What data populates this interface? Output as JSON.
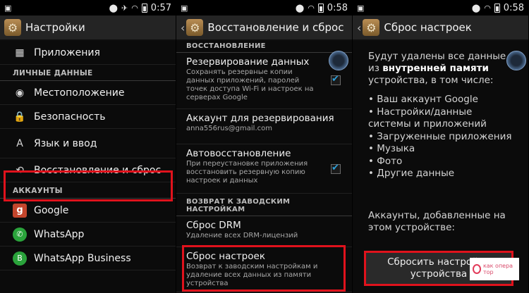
{
  "screen1": {
    "status": {
      "time": "0:57"
    },
    "title": "Настройки",
    "items": [
      {
        "kind": "row",
        "name": "menu-apps",
        "icon": "apps-icon",
        "label": "Приложения"
      },
      {
        "kind": "section",
        "label": "ЛИЧНЫЕ ДАННЫЕ"
      },
      {
        "kind": "row",
        "name": "menu-location",
        "icon": "location-icon",
        "label": "Местоположение"
      },
      {
        "kind": "row",
        "name": "menu-security",
        "icon": "lock-icon",
        "label": "Безопасность"
      },
      {
        "kind": "row",
        "name": "menu-language",
        "icon": "language-icon",
        "label": "Язык и ввод"
      },
      {
        "kind": "row",
        "name": "menu-backup-reset",
        "icon": "backup-icon",
        "label": "Восстановление и сброс"
      },
      {
        "kind": "section",
        "label": "АККАУНТЫ"
      },
      {
        "kind": "row",
        "name": "menu-google",
        "icon": "google-icon",
        "label": "Google"
      },
      {
        "kind": "row",
        "name": "menu-whatsapp",
        "icon": "whatsapp-icon",
        "label": "WhatsApp"
      },
      {
        "kind": "row",
        "name": "menu-whatsapp-business",
        "icon": "whatsapp-business-icon",
        "label": "WhatsApp Business"
      }
    ]
  },
  "screen2": {
    "status": {
      "time": "0:58"
    },
    "title": "Восстановление и сброс",
    "section_restore": "ВОССТАНОВЛЕНИЕ",
    "backup_title": "Резервирование данных",
    "backup_desc": "Сохранять резервные копии данных приложений, паролей точек доступа Wi-Fi и настроек на серверах Google",
    "account_title": "Аккаунт для резервирования",
    "account_value": "anna556rus@gmail.com",
    "autorestore_title": "Автовосстановление",
    "autorestore_desc": "При переустановке приложения восстановить резервную копию настроек и данных",
    "section_factory": "ВОЗВРАТ К ЗАВОДСКИМ НАСТРОЙКАМ",
    "drm_title": "Сброс DRM",
    "drm_desc": "Удаление всех DRM-лицензий",
    "reset_title": "Сброс настроек",
    "reset_desc": "Возврат к заводским настройкам и удаление всех данных из памяти устройства"
  },
  "screen3": {
    "status": {
      "time": "0:58"
    },
    "title": "Сброс настроек",
    "intro_1": "Будут удалены все данные из",
    "intro_bold": "внутренней памяти",
    "intro_2": "устройства, в том числе:",
    "list": [
      "Ваш аккаунт Google",
      "Настройки/данные системы и приложений",
      "Загруженные приложения",
      "Музыка",
      "Фото",
      "Другие данные"
    ],
    "accounts_note": "Аккаунты, добавленные на этом устройстве:",
    "button_label": "Сбросить настройки устройства"
  },
  "watermark": {
    "text": "как опера тор"
  },
  "colors": {
    "highlight": "#e0121c",
    "accent": "#2f9fd8"
  }
}
